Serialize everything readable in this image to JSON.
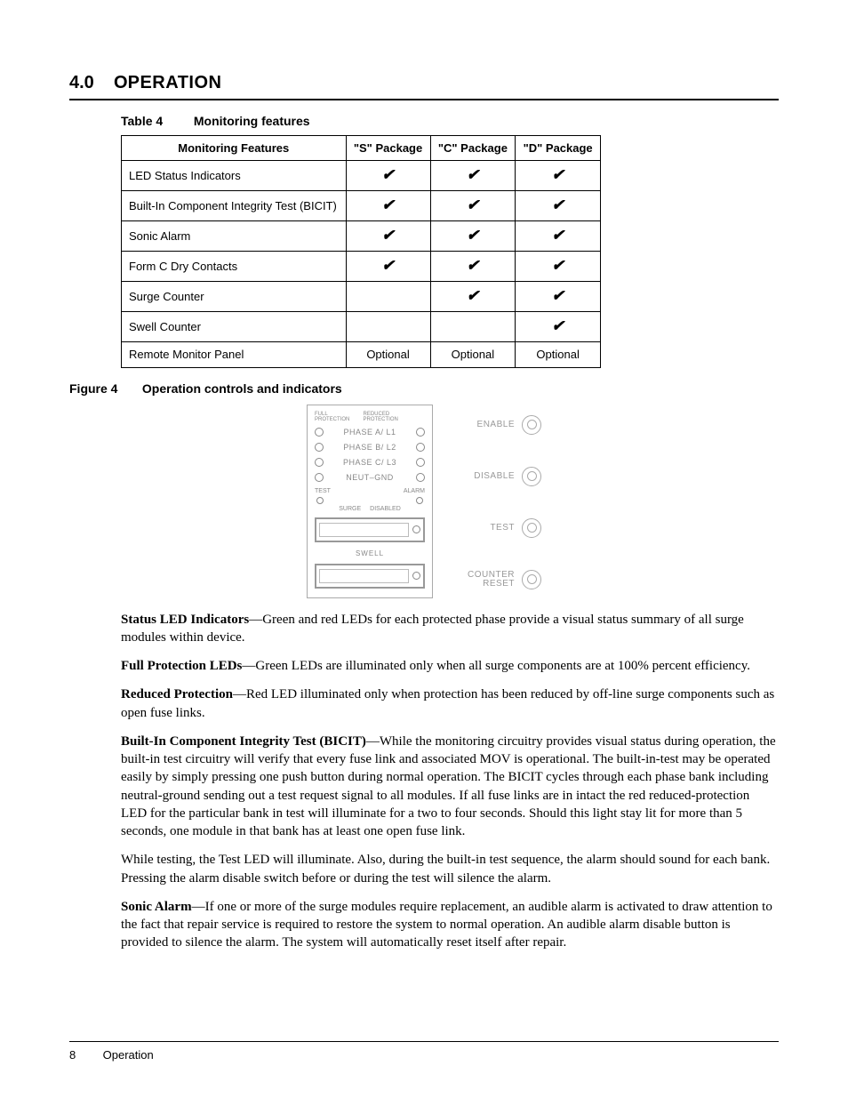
{
  "heading": {
    "num": "4.0",
    "title": "Operation"
  },
  "tableCaption": {
    "label": "Table 4",
    "title": "Monitoring features"
  },
  "tableHeaders": {
    "c0": "Monitoring Features",
    "c1": "\"S\" Package",
    "c2": "\"C\" Package",
    "c3": "\"D\" Package"
  },
  "rows": [
    {
      "f": "LED Status Indicators",
      "s": "✔",
      "c": "✔",
      "d": "✔"
    },
    {
      "f": "Built-In Component Integrity Test (BICIT)",
      "s": "✔",
      "c": "✔",
      "d": "✔"
    },
    {
      "f": "Sonic Alarm",
      "s": "✔",
      "c": "✔",
      "d": "✔"
    },
    {
      "f": "Form C Dry Contacts",
      "s": "✔",
      "c": "✔",
      "d": "✔"
    },
    {
      "f": "Surge Counter",
      "s": "",
      "c": "✔",
      "d": "✔"
    },
    {
      "f": "Swell Counter",
      "s": "",
      "c": "",
      "d": "✔"
    },
    {
      "f": "Remote Monitor Panel",
      "s": "Optional",
      "c": "Optional",
      "d": "Optional"
    }
  ],
  "figCaption": {
    "label": "Figure 4",
    "title": "Operation controls and indicators"
  },
  "panel": {
    "hdrL": "FULL PROTECTION",
    "hdrR": "REDUCED PROTECTION",
    "phA": "PHASE A/ L1",
    "phB": "PHASE B/ L2",
    "phC": "PHASE C/ L3",
    "ng": "NEUT–GND",
    "test": "TEST",
    "alarm": "ALARM",
    "surge": "SURGE",
    "disabled": "DISABLED",
    "swell": "SWELL",
    "btnEnable": "ENABLE",
    "btnDisable": "DISABLE",
    "btnTest": "TEST",
    "btnReset1": "COUNTER",
    "btnReset2": "RESET"
  },
  "paras": {
    "p1t": "Status LED Indicators",
    "p1": "—Green and red LEDs for each protected phase provide a visual status summary of all surge modules within device.",
    "p2t": "Full Protection LEDs",
    "p2": "—Green LEDs are illuminated only when all surge components are at 100% percent efficiency.",
    "p3t": "Reduced Protection",
    "p3": "—Red LED illuminated only when protection has been reduced by off-line surge components such as open fuse links.",
    "p4t": "Built-In Component Integrity Test (BICIT)",
    "p4": "—While the monitoring circuitry provides visual status during operation, the built-in test circuitry will verify that every fuse link and associated MOV is operational. The built-in-test may be operated easily by simply pressing one push button during normal operation. The BICIT cycles through each phase bank including neutral-ground sending out a test request signal to all modules. If all fuse links are in intact the red reduced-protection LED for the particular bank in test will illuminate for a two to four seconds. Should this light stay lit for more than 5 seconds, one module in that bank has at least one open fuse link.",
    "p5": "While testing, the Test LED will illuminate. Also, during the built-in test sequence, the alarm should sound for each bank. Pressing the alarm disable switch before or during the test will silence the alarm.",
    "p6t": "Sonic Alarm",
    "p6": "—If one or more of the surge modules require replacement, an audible alarm is activated to draw attention to the fact that repair service is required to restore the system to normal operation. An audible alarm disable button is provided to silence the alarm. The system will automatically reset itself after repair."
  },
  "footer": {
    "page": "8",
    "section": "Operation"
  }
}
